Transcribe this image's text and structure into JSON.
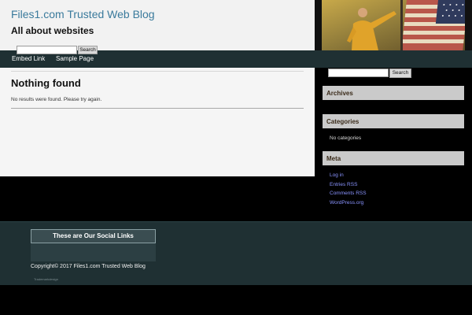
{
  "header": {
    "site_title": "Files1.com Trusted Web Blog",
    "site_description": "All about websites"
  },
  "nav": {
    "items": [
      {
        "label": "Embed Link"
      },
      {
        "label": "Sample Page"
      }
    ]
  },
  "main": {
    "title": "Nothing found",
    "message": "No results were found. Please try again.",
    "search_button": "Search"
  },
  "sidebar": {
    "search_button": "Search",
    "archives_title": "Archives",
    "categories_title": "Categories",
    "categories_empty": "No categories",
    "meta_title": "Meta",
    "meta_links": [
      {
        "label": "Log in"
      },
      {
        "label": "Entries RSS"
      },
      {
        "label": "Comments RSS"
      },
      {
        "label": "WordPress.org"
      }
    ]
  },
  "footer": {
    "social_title": "These are Our Social Links",
    "copyright": "Copyright© 2017 Files1.com Trusted Web Blog",
    "theme_credit": "Trademarkdesign"
  },
  "colors": {
    "nav_bg": "#1f3033",
    "title_link": "#3a7a9c",
    "sidebar_link": "#8a94ff"
  }
}
